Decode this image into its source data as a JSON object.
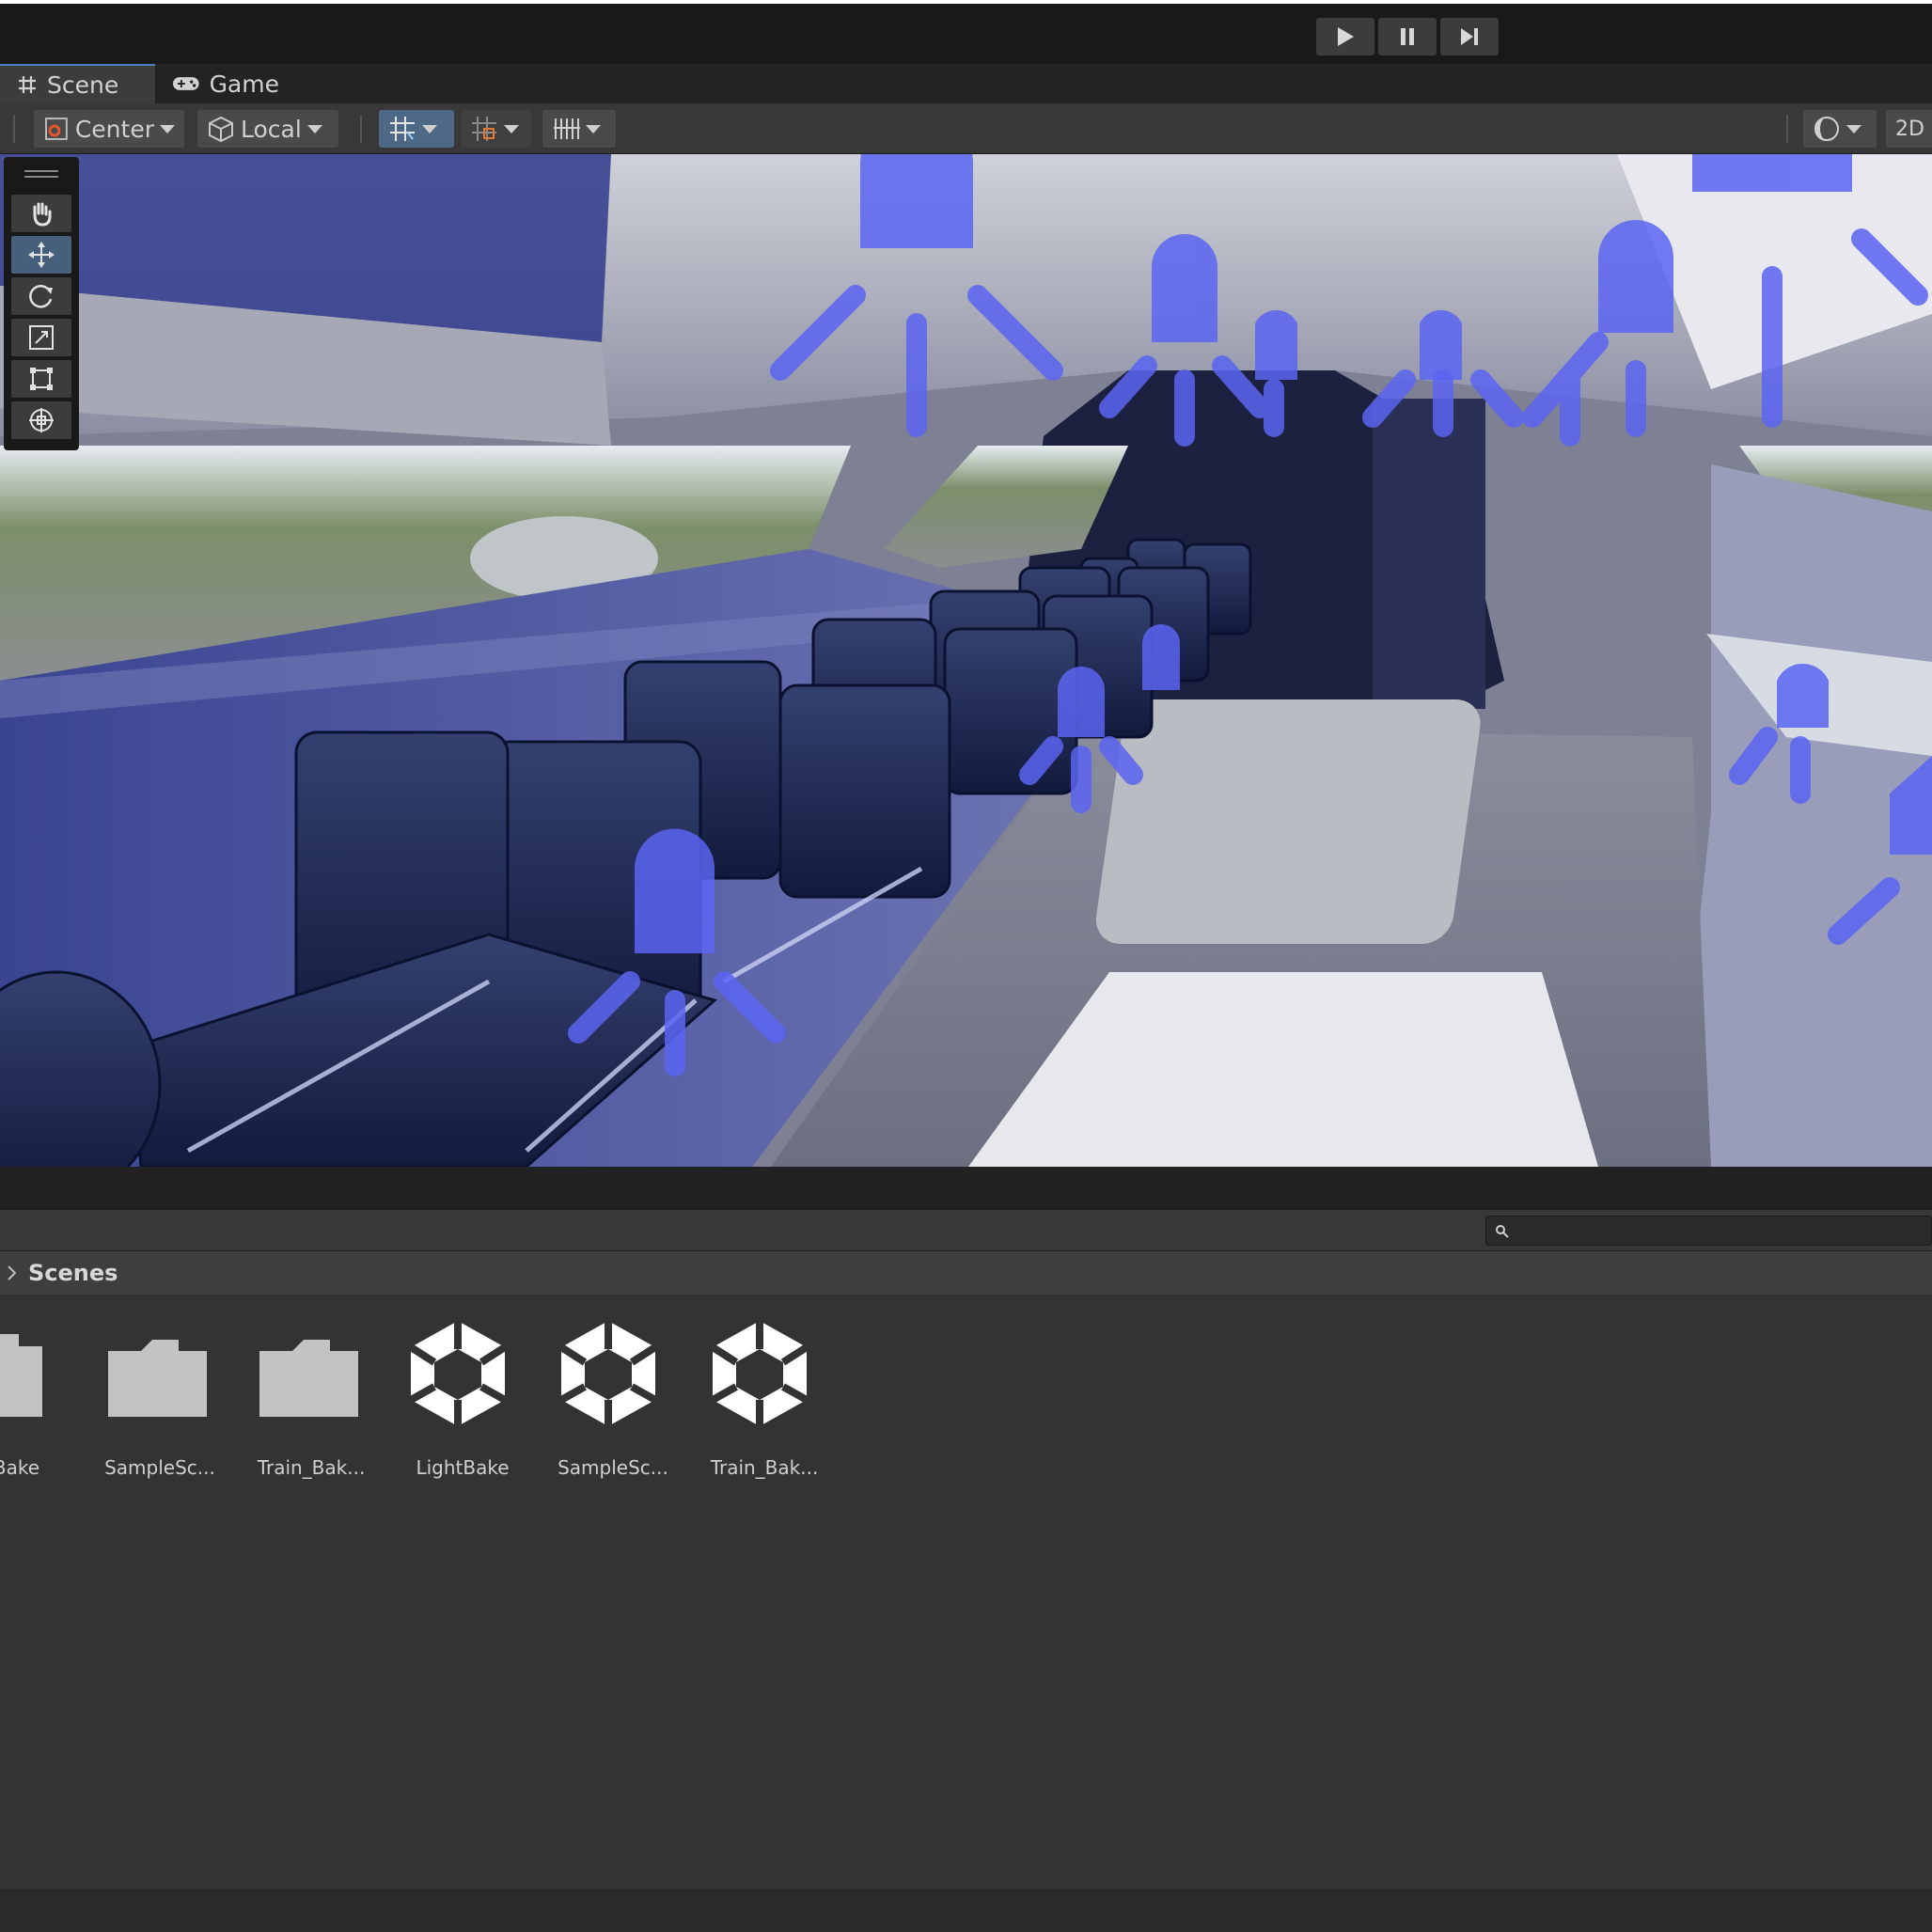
{
  "top_toolbar": {
    "play_icon": "play-icon",
    "pause_icon": "pause-icon",
    "step_icon": "step-icon"
  },
  "tabs": [
    {
      "label": "Scene",
      "icon": "grid-hash-icon"
    },
    {
      "label": "Game",
      "icon": "gamepad-icon"
    }
  ],
  "scene_toolbar": {
    "pivot_label": "Center",
    "space_label": "Local",
    "mode_2d_label": "2D"
  },
  "scene_tools": [
    "hand-tool-icon",
    "move-tool-icon",
    "rotate-tool-icon",
    "scale-tool-icon",
    "rect-tool-icon",
    "transform-tool-icon"
  ],
  "project": {
    "search_placeholder": "",
    "breadcrumb": "Scenes",
    "assets": [
      {
        "name": "tBake",
        "type": "folder"
      },
      {
        "name": "SampleSc...",
        "type": "folder"
      },
      {
        "name": "Train_Bak...",
        "type": "folder"
      },
      {
        "name": "LightBake",
        "type": "scene"
      },
      {
        "name": "SampleSc...",
        "type": "scene"
      },
      {
        "name": "Train_Bak...",
        "type": "scene"
      }
    ]
  },
  "colors": {
    "editor_bg": "#282828",
    "toolbar_bg": "#383838",
    "accent_blue": "#4e6985",
    "light_gizmo": "#5a64f0",
    "seat_blue": "#1f2a5c"
  }
}
